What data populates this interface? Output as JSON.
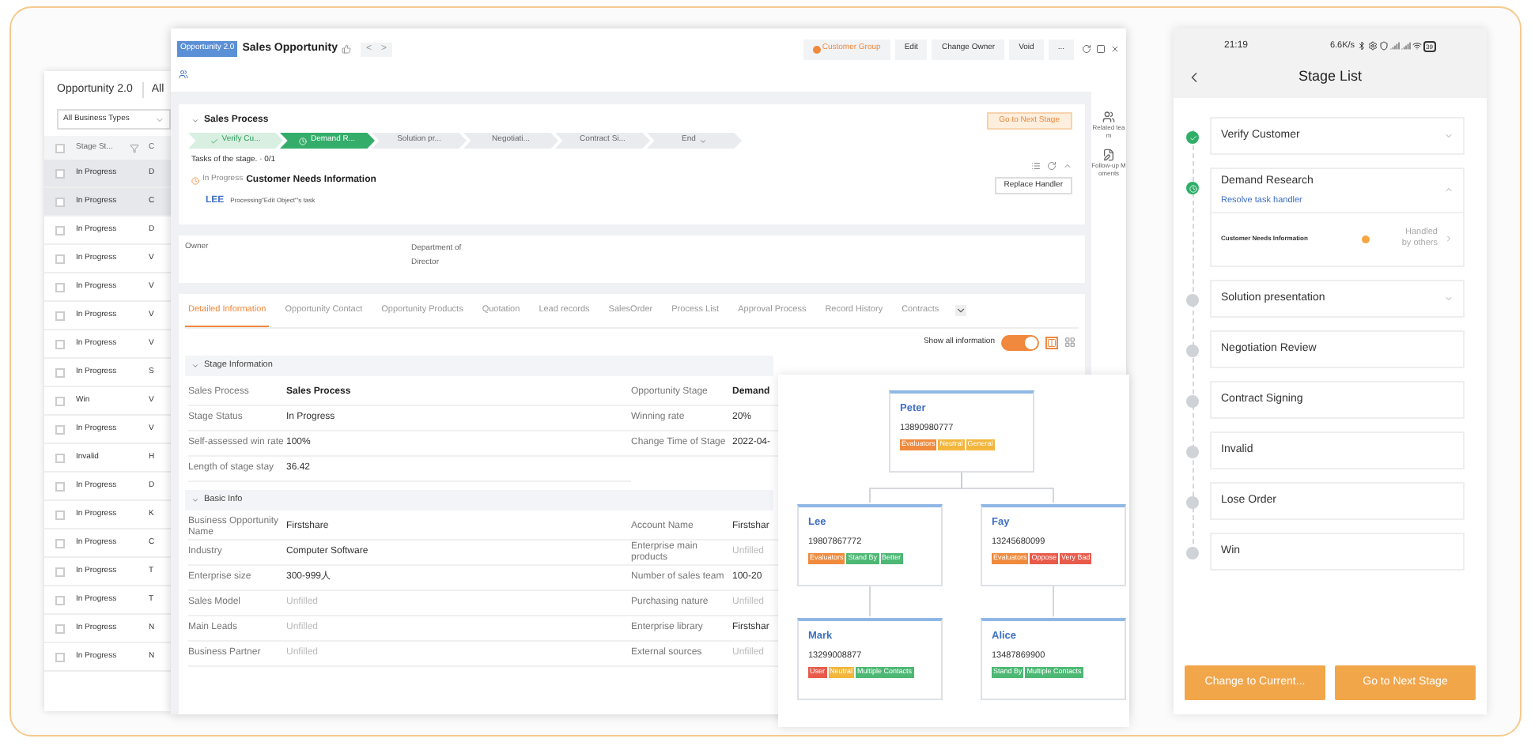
{
  "list_window": {
    "title": "Opportunity 2.0",
    "tab": "All",
    "filter": "All Business Types",
    "columns": [
      "Stage St...",
      "C"
    ],
    "select_all": false,
    "rows": [
      {
        "stage": "In Progress",
        "column_2": "D",
        "selected": true
      },
      {
        "stage": "In Progress",
        "column_2": "C",
        "selected": true
      },
      {
        "stage": "In Progress",
        "column_2": "D",
        "selected": false
      },
      {
        "stage": "In Progress",
        "column_2": "V",
        "selected": false
      },
      {
        "stage": "In Progress",
        "column_2": "V",
        "selected": false
      },
      {
        "stage": "In Progress",
        "column_2": "V",
        "selected": false
      },
      {
        "stage": "In Progress",
        "column_2": "V",
        "selected": false
      },
      {
        "stage": "In Progress",
        "column_2": "S",
        "selected": false
      },
      {
        "stage": "Win",
        "column_2": "V",
        "selected": false
      },
      {
        "stage": "In Progress",
        "column_2": "V",
        "selected": false
      },
      {
        "stage": "Invalid",
        "column_2": "H",
        "selected": false
      },
      {
        "stage": "In Progress",
        "column_2": "D",
        "selected": false
      },
      {
        "stage": "In Progress",
        "column_2": "K",
        "selected": false
      },
      {
        "stage": "In Progress",
        "column_2": "C",
        "selected": false
      },
      {
        "stage": "In Progress",
        "column_2": "T",
        "selected": false
      },
      {
        "stage": "In Progress",
        "column_2": "T",
        "selected": false
      },
      {
        "stage": "In Progress",
        "column_2": "N",
        "selected": false
      },
      {
        "stage": "In Progress",
        "column_2": "N",
        "selected": false
      }
    ]
  },
  "detail_window": {
    "breadcrumb": "Opportunity 2.0",
    "title": "Sales Opportunity",
    "nav": [
      "<",
      ">"
    ],
    "actions": [
      {
        "label": "Customer Group",
        "kind": "group"
      },
      {
        "label": "Edit",
        "kind": "plain"
      },
      {
        "label": "Change Owner",
        "kind": "plain"
      },
      {
        "label": "Void",
        "kind": "plain"
      },
      {
        "label": "...",
        "kind": "plain"
      }
    ],
    "sales_process": {
      "title": "Sales Process",
      "stages": [
        {
          "label": "Verify Cu...",
          "done": true,
          "current": false,
          "dropdown": false
        },
        {
          "label": "Demand R...",
          "done": false,
          "current": true,
          "dropdown": false
        },
        {
          "label": "Solution pr...",
          "done": false,
          "current": false,
          "dropdown": false
        },
        {
          "label": "Negotiati...",
          "done": false,
          "current": false,
          "dropdown": false
        },
        {
          "label": "Contract Si...",
          "done": false,
          "current": false,
          "dropdown": false
        },
        {
          "label": "End",
          "done": false,
          "current": false,
          "dropdown": true
        }
      ],
      "next_button": "Go to Next Stage",
      "tasks_label": "Tasks of the stage. · 0/1",
      "task": {
        "status": "In Progress",
        "name": "Customer Needs Information",
        "handler": "LEE",
        "note": "Processing\"Edit Object\"'s task"
      },
      "replace_button": "Replace Handler"
    },
    "side_rail": [
      {
        "label": "Related team"
      },
      {
        "label": "Follow-up Moments"
      }
    ],
    "owner": {
      "label": "Owner",
      "department": "Department of Director"
    },
    "tabs": [
      {
        "label": "Detailed Information",
        "selected": true
      },
      {
        "label": "Opportunity Contact",
        "selected": false
      },
      {
        "label": "Opportunity Products",
        "selected": false
      },
      {
        "label": "Quotation",
        "selected": false
      },
      {
        "label": "Lead records",
        "selected": false
      },
      {
        "label": "SalesOrder",
        "selected": false
      },
      {
        "label": "Process List",
        "selected": false
      },
      {
        "label": "Approval Process",
        "selected": false
      },
      {
        "label": "Record History",
        "selected": false
      },
      {
        "label": "Contracts",
        "selected": false
      }
    ],
    "show_all": {
      "label": "Show all information",
      "on": true
    },
    "sections": [
      {
        "title": "Stage Information",
        "left": [
          {
            "label": "Sales Process",
            "value": "Sales Process",
            "kind": "bold"
          },
          {
            "label": "Stage Status",
            "value": "In Progress",
            "kind": "plain"
          },
          {
            "label": "Self-assessed win rate",
            "value": "100%",
            "kind": "plain"
          },
          {
            "label": "Length of stage stay",
            "value": "36.42",
            "kind": "plain"
          }
        ],
        "right": [
          {
            "label": "Opportunity Stage",
            "value": "Demand",
            "kind": "bold"
          },
          {
            "label": "Winning rate",
            "value": "20%",
            "kind": "plain"
          },
          {
            "label": "Change Time of Stage",
            "value": "2022-04-",
            "kind": "plain"
          }
        ]
      },
      {
        "title": "Basic Info",
        "left": [
          {
            "label": "Business Opportunity Name",
            "value": "Firstshare",
            "kind": "plain"
          },
          {
            "label": "Industry",
            "value": "Computer Software",
            "kind": "plain"
          },
          {
            "label": "Enterprise size",
            "value": "300-999人",
            "kind": "plain"
          },
          {
            "label": "Sales Model",
            "value": "Unfilled",
            "kind": "unfilled"
          },
          {
            "label": "Main Leads",
            "value": "Unfilled",
            "kind": "unfilled"
          },
          {
            "label": "Business Partner",
            "value": "Unfilled",
            "kind": "unfilled"
          }
        ],
        "right": [
          {
            "label": "Account Name",
            "value": "Firstshar",
            "kind": "plain"
          },
          {
            "label": "Enterprise main products",
            "value": "Unfilled",
            "kind": "unfilled"
          },
          {
            "label": "Number of sales team",
            "value": "100-20",
            "kind": "plain"
          },
          {
            "label": "Purchasing nature",
            "value": "Unfilled",
            "kind": "unfilled"
          },
          {
            "label": "Enterprise library",
            "value": "Firstshar",
            "kind": "plain"
          },
          {
            "label": "External sources",
            "value": "Unfilled",
            "kind": "unfilled"
          }
        ]
      }
    ]
  },
  "org_chart": {
    "root": {
      "name": "Peter",
      "phone": "13890980777",
      "tags": [
        {
          "label": "Evaluators",
          "color": "#f08a3c"
        },
        {
          "label": "Neutral",
          "color": "#f2b63c"
        },
        {
          "label": "General",
          "color": "#f2b63c"
        }
      ],
      "children": [
        {
          "name": "Lee",
          "phone": "19807867772",
          "tags": [
            {
              "label": "Evaluators",
              "color": "#f08a3c"
            },
            {
              "label": "Stand By",
              "color": "#4cb874"
            },
            {
              "label": "Better",
              "color": "#4cb874"
            }
          ],
          "children": [
            {
              "name": "Mark",
              "phone": "13299008877",
              "tags": [
                {
                  "label": "User",
                  "color": "#e85a4a"
                },
                {
                  "label": "Neutral",
                  "color": "#f2b63c"
                },
                {
                  "label": "Multiple Contacts",
                  "color": "#4cb874"
                }
              ]
            }
          ]
        },
        {
          "name": "Fay",
          "phone": "13245680099",
          "tags": [
            {
              "label": "Evaluators",
              "color": "#f08a3c"
            },
            {
              "label": "Oppose",
              "color": "#e85a4a"
            },
            {
              "label": "Very Bad",
              "color": "#e85a4a"
            }
          ],
          "children": [
            {
              "name": "Alice",
              "phone": "13487869900",
              "tags": [
                {
                  "label": "Stand By",
                  "color": "#4cb874"
                },
                {
                  "label": "Multiple Contacts",
                  "color": "#4cb874"
                }
              ]
            }
          ]
        }
      ]
    }
  },
  "phone": {
    "time": "21:19",
    "speed": "6.6K/s",
    "battery": "39",
    "title": "Stage List",
    "stages": [
      {
        "name": "Verify Customer",
        "done": true,
        "current": false,
        "expanded": false,
        "collapsible": true
      },
      {
        "name": "Demand Research",
        "done": false,
        "current": true,
        "expanded": true,
        "collapsible": true,
        "link": "Resolve task handler",
        "task": {
          "name": "Customer Needs Information",
          "state": "Handled by others"
        }
      },
      {
        "name": "Solution presentation",
        "done": false,
        "current": false,
        "expanded": false,
        "collapsible": true
      },
      {
        "name": "Negotiation Review",
        "done": false,
        "current": false,
        "collapsible": false
      },
      {
        "name": "Contract Signing",
        "done": false,
        "current": false,
        "collapsible": false
      },
      {
        "name": "Invalid",
        "done": false,
        "current": false,
        "collapsible": false
      },
      {
        "name": "Lose Order",
        "done": false,
        "current": false,
        "collapsible": false
      },
      {
        "name": "Win",
        "done": false,
        "current": false,
        "collapsible": false
      }
    ],
    "buttons": [
      "Change to Current...",
      "Go to Next Stage"
    ]
  }
}
